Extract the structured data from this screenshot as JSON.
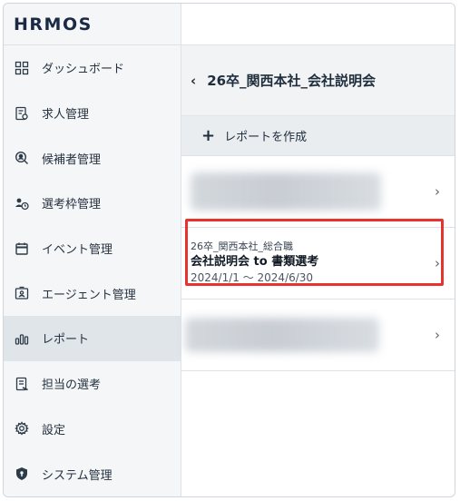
{
  "brand": {
    "logo_text": "HRMOS"
  },
  "sidebar": {
    "items": [
      {
        "label": "ダッシュボード",
        "icon": "dashboard-icon"
      },
      {
        "label": "求人管理",
        "icon": "job-document-icon"
      },
      {
        "label": "候補者管理",
        "icon": "candidate-search-icon"
      },
      {
        "label": "選考枠管理",
        "icon": "people-clock-icon"
      },
      {
        "label": "イベント管理",
        "icon": "calendar-icon"
      },
      {
        "label": "エージェント管理",
        "icon": "agent-card-icon"
      },
      {
        "label": "レポート",
        "icon": "bar-chart-icon",
        "active": true
      },
      {
        "label": "担当の選考",
        "icon": "assigned-doc-icon"
      },
      {
        "label": "設定",
        "icon": "gear-icon"
      },
      {
        "label": "システム管理",
        "icon": "shield-icon"
      }
    ]
  },
  "panel": {
    "back_symbol": "‹",
    "title": "26卒_関西本社_会社説明会",
    "create_symbol": "+",
    "create_label": "レポートを作成"
  },
  "reports": [
    {
      "blurred": true,
      "chevron": "›"
    },
    {
      "blurred": false,
      "subtitle": "26卒_関西本社_総合職",
      "title": "会社説明会 to 書類選考",
      "dates": "2024/1/1 ～ 2024/6/30",
      "chevron": "›",
      "highlighted": true
    },
    {
      "blurred": true,
      "chevron": "›"
    }
  ],
  "colors": {
    "highlight": "#e8322e",
    "sidebar_bg": "#f4f6f8",
    "active_bg": "#e0e5ea",
    "header_bg": "#f1f3f5"
  }
}
